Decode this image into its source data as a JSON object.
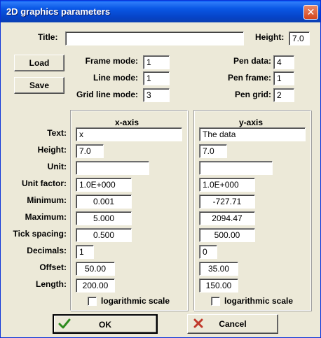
{
  "window": {
    "title": "2D graphics parameters",
    "close_symbol": "✕"
  },
  "top": {
    "title_label": "Title:",
    "title_value": "",
    "height_label": "Height:",
    "height_value": "7.0"
  },
  "buttons": {
    "load": "Load",
    "save": "Save",
    "ok": "OK",
    "cancel": "Cancel"
  },
  "modes": {
    "frame_mode_label": "Frame mode:",
    "frame_mode_value": "1",
    "line_mode_label": "Line mode:",
    "line_mode_value": "1",
    "grid_line_mode_label": "Grid line mode:",
    "grid_line_mode_value": "3",
    "pen_data_label": "Pen data:",
    "pen_data_value": "4",
    "pen_frame_label": "Pen frame:",
    "pen_frame_value": "1",
    "pen_grid_label": "Pen grid:",
    "pen_grid_value": "2"
  },
  "axis_labels": {
    "text": "Text:",
    "height": "Height:",
    "unit": "Unit:",
    "unit_factor": "Unit factor:",
    "minimum": "Minimum:",
    "maximum": "Maximum:",
    "tick_spacing": "Tick spacing:",
    "decimals": "Decimals:",
    "offset": "Offset:",
    "length": "Length:"
  },
  "x_axis": {
    "header": "x-axis",
    "text": "x",
    "height": "7.0",
    "unit": "",
    "unit_factor": "1.0E+000",
    "minimum": "0.001",
    "maximum": "5.000",
    "tick_spacing": "0.500",
    "decimals": "1",
    "offset": "50.00",
    "length": "200.00",
    "log_label": "logarithmic scale",
    "log_checked": false
  },
  "y_axis": {
    "header": "y-axis",
    "text": "The data",
    "height": "7.0",
    "unit": "",
    "unit_factor": "1.0E+000",
    "minimum": "-727.71",
    "maximum": "2094.47",
    "tick_spacing": "500.00",
    "decimals": "0",
    "offset": "35.00",
    "length": "150.00",
    "log_label": "logarithmic scale",
    "log_checked": false
  },
  "icons": {
    "ok": "checkmark-icon",
    "cancel": "x-cross-icon",
    "ok_color": "#2e8b1f",
    "cancel_color": "#c0392b"
  }
}
